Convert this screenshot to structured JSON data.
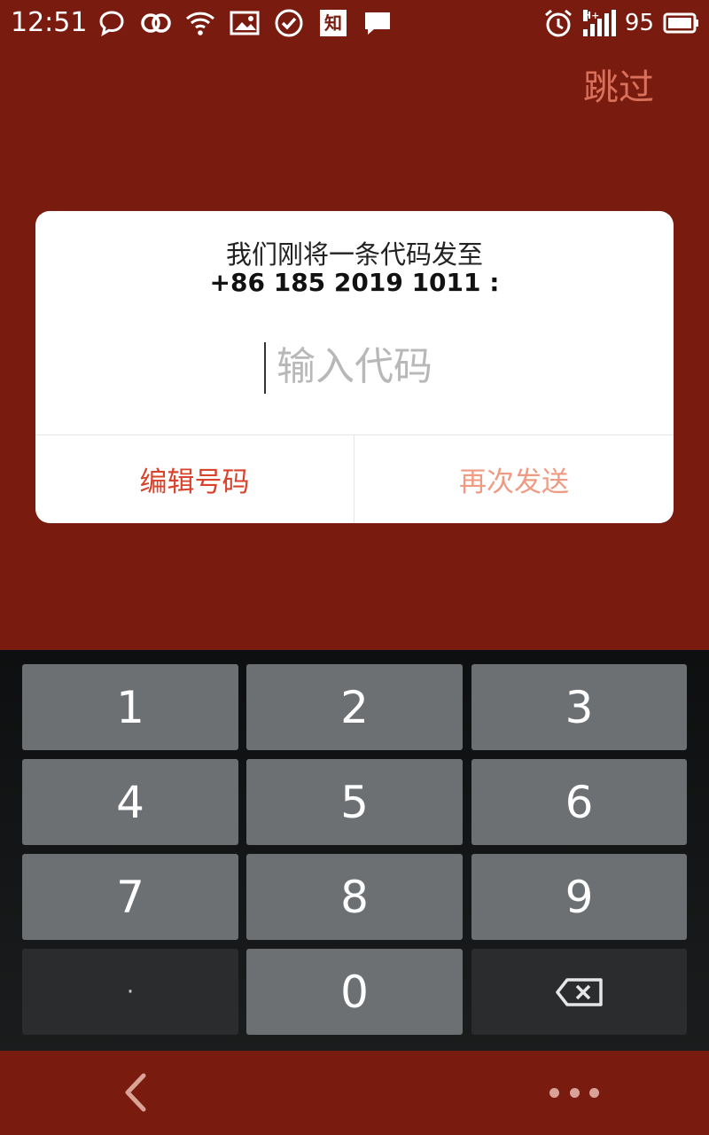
{
  "status_bar": {
    "time": "12:51",
    "battery_level": "95",
    "left_icons": [
      "chat-bubble-icon",
      "double-circle-icon",
      "wifi-icon",
      "image-icon",
      "check-circle-icon",
      "zhihu-icon",
      "message-icon"
    ],
    "zhihu_char": "知",
    "right_icons": [
      "alarm-icon",
      "signal-icon",
      "battery-icon"
    ]
  },
  "header": {
    "skip_label": "跳过"
  },
  "dialog": {
    "message_line1": "我们刚将一条代码发至",
    "message_line2": "+86 185 2019 1011 :",
    "code_input": {
      "value": "",
      "placeholder": "输入代码"
    },
    "edit_number_label": "编辑号码",
    "resend_label": "再次发送"
  },
  "keypad": {
    "keys": [
      "1",
      "2",
      "3",
      "4",
      "5",
      "6",
      "7",
      "8",
      "9",
      "·",
      "0",
      "backspace-icon"
    ]
  },
  "bottom_nav": {
    "items": [
      "back-chevron-icon",
      "more-dots-icon"
    ]
  },
  "colors": {
    "background": "#791b0e",
    "skip": "#d8705c",
    "edit_button": "#d8432b",
    "resend_button": "#ef9a82",
    "key": "#6c7073",
    "key_dark": "#2a2c2e"
  }
}
